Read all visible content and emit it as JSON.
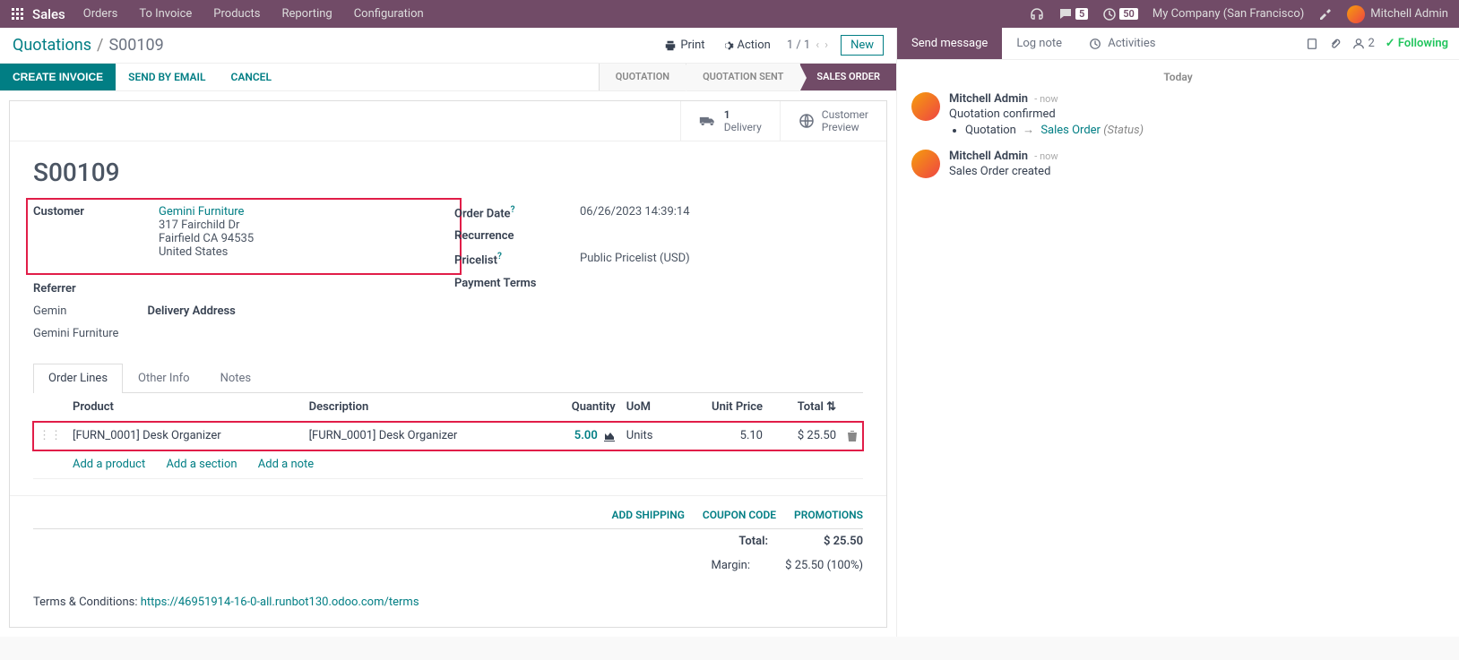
{
  "nav": {
    "brand": "Sales",
    "items": [
      "Orders",
      "To Invoice",
      "Products",
      "Reporting",
      "Configuration"
    ],
    "chat_badge": "5",
    "clock_badge": "50",
    "company": "My Company (San Francisco)",
    "user": "Mitchell Admin"
  },
  "breadcrumb": {
    "parent": "Quotations",
    "current": "S00109",
    "print": "Print",
    "action": "Action",
    "pager": "1 / 1",
    "new": "New"
  },
  "actions": {
    "create_invoice": "CREATE INVOICE",
    "send_email": "SEND BY EMAIL",
    "cancel": "CANCEL"
  },
  "status": [
    "QUOTATION",
    "QUOTATION SENT",
    "SALES ORDER"
  ],
  "card_btns": {
    "delivery_count": "1",
    "delivery_label": "Delivery",
    "preview_label1": "Customer",
    "preview_label2": "Preview"
  },
  "order": {
    "title": "S00109",
    "labels": {
      "customer": "Customer",
      "referrer": "Referrer",
      "gemin": "Gemin",
      "delivery_address": "Delivery Address",
      "gemini_furniture2": "Gemini Furniture",
      "order_date": "Order Date",
      "recurrence": "Recurrence",
      "pricelist": "Pricelist",
      "payment_terms": "Payment Terms"
    },
    "customer_name": "Gemini Furniture",
    "addr1": "317 Fairchild Dr",
    "addr2": "Fairfield CA 94535",
    "addr3": "United States",
    "order_date_val": "06/26/2023 14:39:14",
    "pricelist_val": "Public Pricelist (USD)"
  },
  "tabs": [
    "Order Lines",
    "Other Info",
    "Notes"
  ],
  "table": {
    "headers": {
      "product": "Product",
      "description": "Description",
      "quantity": "Quantity",
      "uom": "UoM",
      "unit_price": "Unit Price",
      "total": "Total"
    },
    "row": {
      "product": "[FURN_0001] Desk Organizer",
      "description": "[FURN_0001] Desk Organizer",
      "quantity": "5.00",
      "uom": "Units",
      "unit_price": "5.10",
      "total": "$ 25.50"
    },
    "add_product": "Add a product",
    "add_section": "Add a section",
    "add_note": "Add a note"
  },
  "promo": {
    "shipping": "ADD SHIPPING",
    "coupon": "COUPON CODE",
    "promotions": "PROMOTIONS"
  },
  "totals": {
    "total_lbl": "Total:",
    "total_val": "$ 25.50",
    "margin_lbl": "Margin:",
    "margin_val": "$ 25.50 (100%)"
  },
  "terms": {
    "label": "Terms & Conditions: ",
    "url": "https://46951914-16-0-all.runbot130.odoo.com/terms"
  },
  "side": {
    "send": "Send message",
    "log": "Log note",
    "activities": "Activities",
    "followers": "2",
    "following": "Following",
    "today": "Today",
    "msg1": {
      "who": "Mitchell Admin",
      "when": "- now",
      "body": "Quotation confirmed",
      "li_label": "Quotation",
      "li_link": "Sales Order",
      "li_status": "(Status)"
    },
    "msg2": {
      "who": "Mitchell Admin",
      "when": "- now",
      "body": "Sales Order created"
    }
  }
}
